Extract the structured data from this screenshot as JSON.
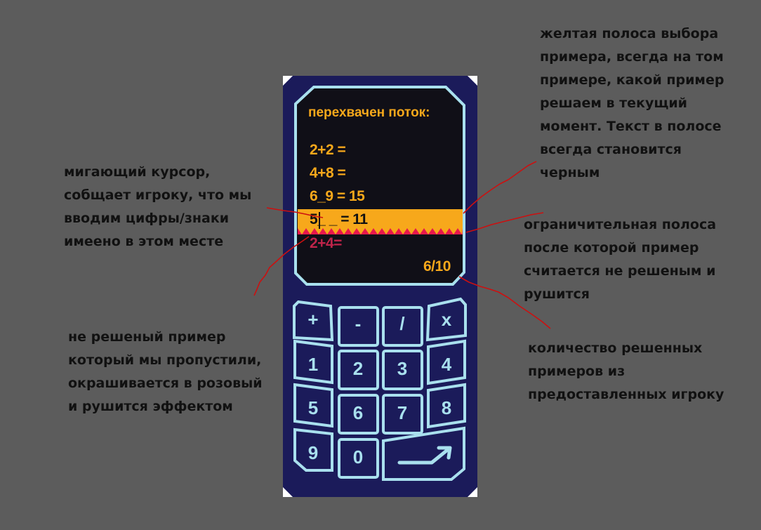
{
  "colors": {
    "background": "#5c5c5c",
    "device_body": "#1b1b5a",
    "screen": "#100f17",
    "accent_border": "#a9e0ee",
    "equation_text": "#f7a81b",
    "selection_bar": "#f7a81b",
    "limit_band": "#e8184c",
    "unsolved_text": "#c0244a",
    "annotation_line": "#cc1010"
  },
  "screen": {
    "title": "перехвачен поток:",
    "equations": [
      "2+2 =",
      "4+8 =",
      "6_9 = 15",
      "5_ _ = 11",
      "2+4="
    ],
    "selected_index": 3,
    "unsolved_index": 4,
    "score": "6/10"
  },
  "keypad": {
    "operators": [
      "+",
      "-",
      "/",
      "x"
    ],
    "row1": [
      "1",
      "2",
      "3",
      "4"
    ],
    "row2": [
      "5",
      "6",
      "7",
      "8"
    ],
    "row3": [
      "9",
      "0"
    ],
    "enter_icon": "arrow-enter-icon"
  },
  "annotations": {
    "cursor": [
      "мигающий курсор,",
      "собщает игроку, что мы",
      "вводим цифры/знаки",
      "имеено в этом месте"
    ],
    "unsolved": [
      "не решеный пример",
      "который мы пропустили,",
      "окрашивается в розовый",
      "и рушится эффектом"
    ],
    "yellow_bar": [
      "желтая полоса выбора",
      "примера, всегда на том",
      "примере, какой пример",
      "решаем в текущий",
      "момент. Текст в полосе",
      "всегда становится",
      "черным"
    ],
    "limit_band": [
      "ограничительная полоса",
      "после которой пример",
      "считается не решеным и",
      "рушится"
    ],
    "count": [
      "количество решенных",
      "примеров из",
      "предоставленных игроку"
    ]
  }
}
